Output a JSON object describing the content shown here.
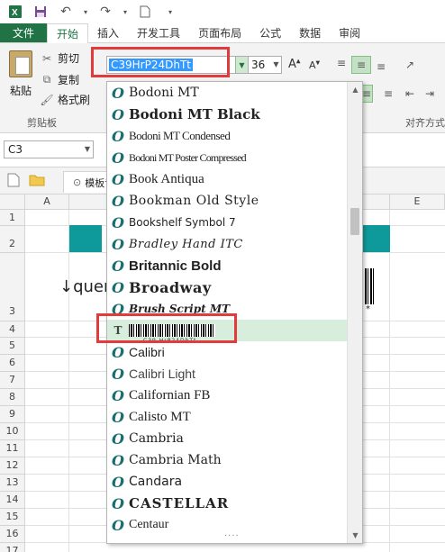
{
  "ribbon": {
    "tabs": [
      "文件",
      "开始",
      "插入",
      "开发工具",
      "页面布局",
      "公式",
      "数据",
      "审阅"
    ],
    "active_tab": "开始",
    "clipboard": {
      "paste": "粘贴",
      "cut": "剪切",
      "copy": "复制",
      "format_painter": "格式刷",
      "group_label": "剪贴板"
    },
    "font": {
      "name": "C39HrP24DhTt",
      "size": "36",
      "grow": "A",
      "shrink": "A"
    },
    "alignment_group_label": "对齐方式"
  },
  "formula_bar": {
    "name_box": "C3"
  },
  "sheet_tabs": {
    "file_tab": "模板专"
  },
  "grid": {
    "columns": [
      "A",
      "E"
    ],
    "rows": [
      "1",
      "2",
      "3",
      "4",
      "5",
      "6",
      "7",
      "8",
      "9",
      "10",
      "11",
      "12",
      "13",
      "14",
      "15",
      "16",
      "17"
    ],
    "cell_text": "↓quer",
    "star": "*"
  },
  "font_list": {
    "items": [
      "Bodoni MT",
      "Bodoni MT Black",
      "Bodoni MT Condensed",
      "Bodoni MT Poster Compressed",
      "Book Antiqua",
      "Bookman Old Style",
      "Bookshelf Symbol 7",
      "Bradley Hand ITC",
      "Britannic Bold",
      "Broadway",
      "Brush Script MT",
      "C39HrP24DhTt",
      "Calibri",
      "Calibri Light",
      "Californian FB",
      "Calisto MT",
      "Cambria",
      "Cambria Math",
      "Candara",
      "CASTELLAR",
      "Centaur"
    ],
    "selected": "C39HrP24DhTt",
    "barcode_digits": "C39 HrP24DhTt",
    "icon_o": "O",
    "icon_t": "T"
  },
  "colors": {
    "accent": "#217346",
    "highlight_box": "#e23b3b",
    "teal": "#0e9a9a"
  }
}
